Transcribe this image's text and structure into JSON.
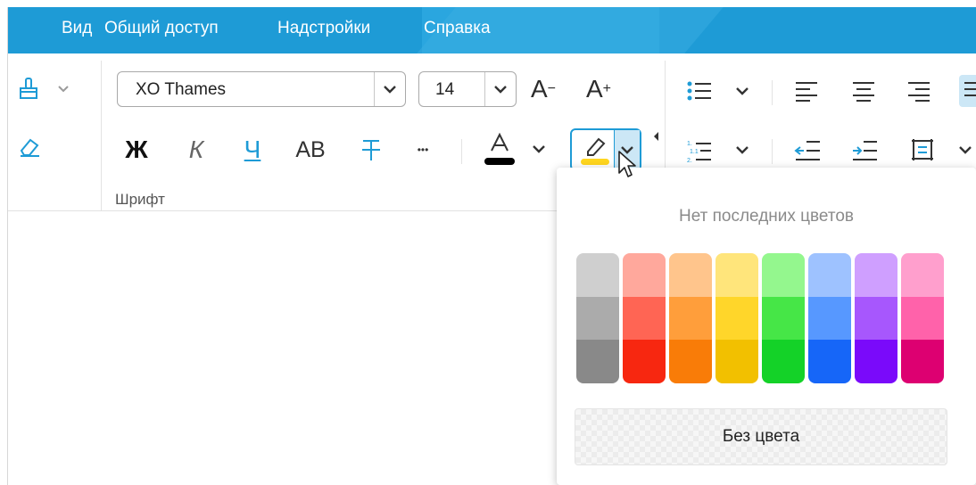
{
  "menu": {
    "items": [
      "Вид",
      "Общий доступ",
      "Надстройки",
      "Справка"
    ]
  },
  "font": {
    "name": "XO Thames",
    "size": "14",
    "group_label": "Шрифт",
    "bold": "Ж",
    "italic": "К",
    "underline": "Ч",
    "caps": "АВ",
    "more": "•••",
    "grow": "A",
    "shrink": "A"
  },
  "highlight_color": "#ffd61f",
  "font_color": "#000000",
  "accent": "#1e9bd6",
  "panel": {
    "title": "Нет последних цветов",
    "no_color": "Без цвета",
    "palette": [
      [
        "#cfcfcf",
        "#ababab",
        "#898989"
      ],
      [
        "#ffa89c",
        "#ff6554",
        "#f72710"
      ],
      [
        "#ffc58c",
        "#ff9e3b",
        "#f97c08"
      ],
      [
        "#ffe57b",
        "#ffd62a",
        "#f2c000"
      ],
      [
        "#94f78e",
        "#46e647",
        "#14d228"
      ],
      [
        "#9ec2ff",
        "#5798ff",
        "#1666f8"
      ],
      [
        "#cf9fff",
        "#a757fd",
        "#7a0afa"
      ],
      [
        "#ff9fcd",
        "#ff62aa",
        "#dd0071"
      ]
    ]
  }
}
